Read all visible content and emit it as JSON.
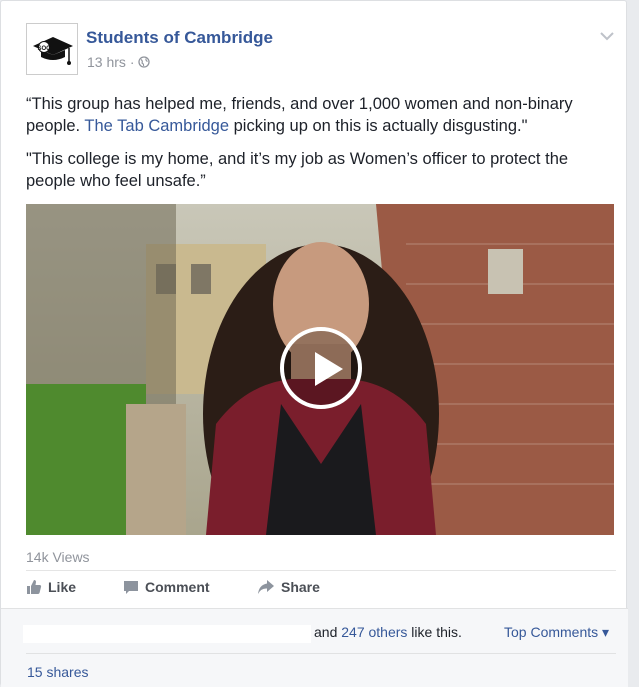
{
  "post": {
    "page_name": "Students of Cambridge",
    "time": "13 hrs",
    "dot": "·",
    "paragraph1_before": "“This group has helped me, friends, and over 1,000 women and non-binary people. ",
    "paragraph1_link": "The Tab Cambridge",
    "paragraph1_after": " picking up on this is actually disgusting.\"",
    "paragraph2": "\"This college is my home, and it’s my job as Women’s officer to protect the people who feel unsafe.”",
    "views": "14k Views"
  },
  "logo_text": "SOC",
  "actions": {
    "like": "Like",
    "comment": "Comment",
    "share": "Share"
  },
  "footer": {
    "likes_prefix": "and ",
    "likes_link": "247 others",
    "likes_suffix": " like this.",
    "top_comments": "Top Comments ▾",
    "shares": "15 shares"
  },
  "icons": [
    "globe-icon",
    "chevron-down-icon",
    "play-icon",
    "like-icon",
    "comment-icon",
    "share-icon"
  ],
  "colors": {
    "link": "#365899",
    "meta": "#90949c",
    "footer_bg": "#f6f7f9"
  }
}
